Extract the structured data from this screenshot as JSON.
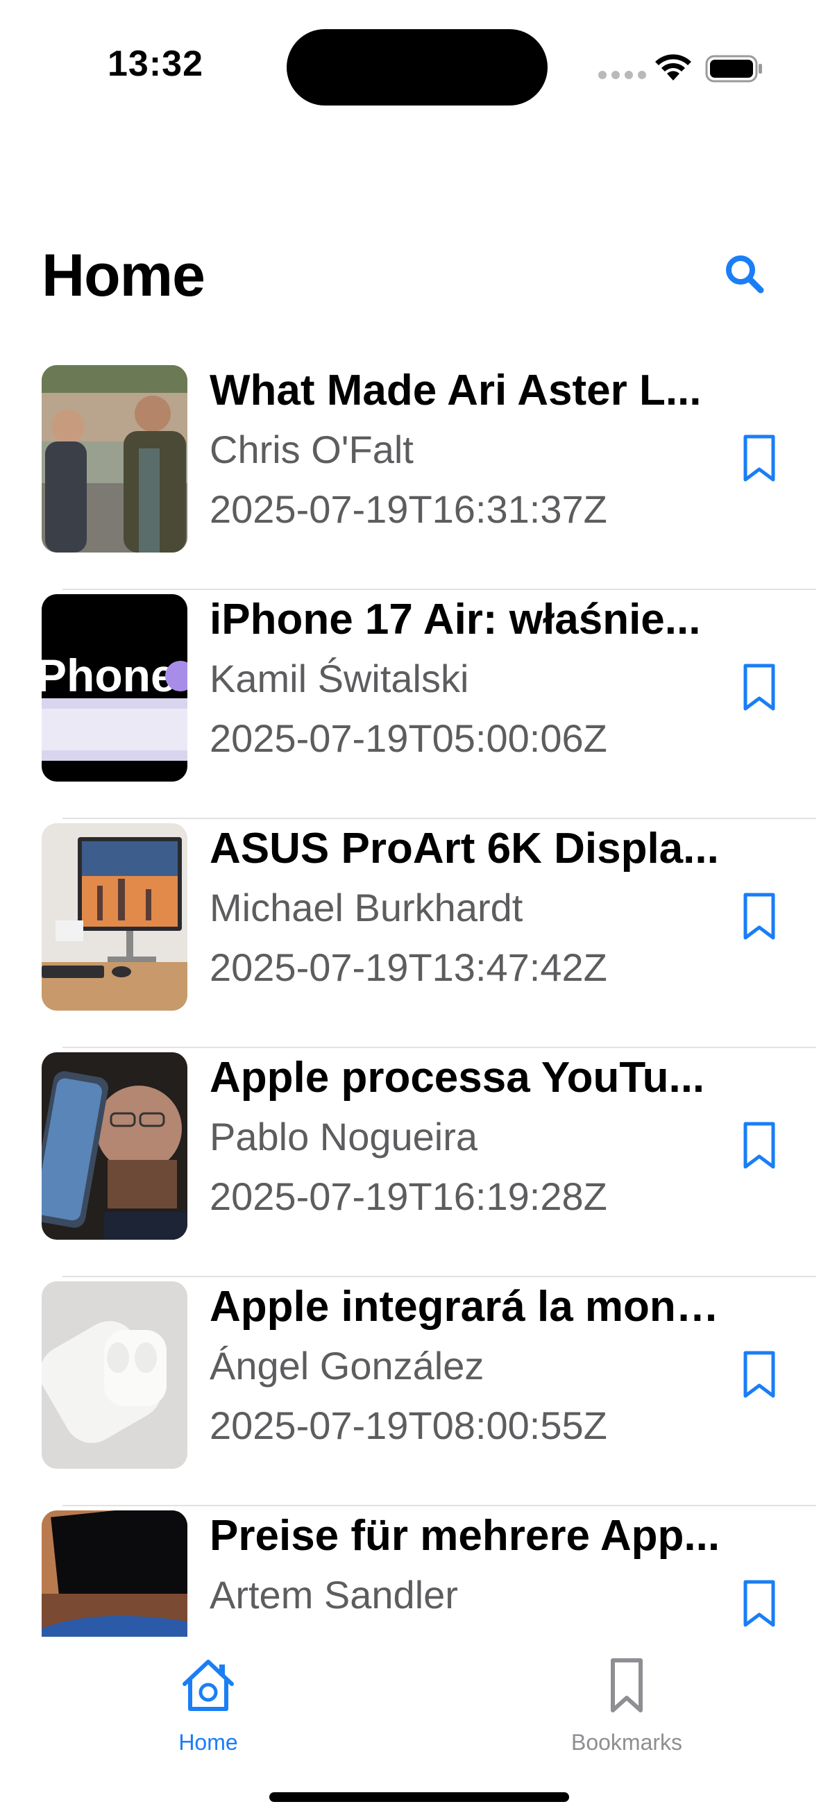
{
  "status_bar": {
    "time": "13:32"
  },
  "header": {
    "title": "Home",
    "search_icon": "magnifying-glass"
  },
  "colors": {
    "accent": "#1a7ef5",
    "secondary_text": "#5d5d60",
    "inactive_tab": "#8e8e93"
  },
  "articles": [
    {
      "title": "What Made Ari Aster L...",
      "author": "Chris O'Falt",
      "date": "2025-07-19T16:31:37Z"
    },
    {
      "title": "iPhone 17 Air: właśnie...",
      "author": "Kamil Świtalski",
      "date": "2025-07-19T05:00:06Z",
      "thumb_text": "Phone"
    },
    {
      "title": "ASUS ProArt 6K Displa...",
      "author": "Michael Burkhardt",
      "date": "2025-07-19T13:47:42Z"
    },
    {
      "title": "Apple processa YouTu...",
      "author": "Pablo Nogueira",
      "date": "2025-07-19T16:19:28Z"
    },
    {
      "title": "Apple integrará la moni...",
      "author": "Ángel González",
      "date": "2025-07-19T08:00:55Z"
    },
    {
      "title": "Preise für mehrere App...",
      "author": "Artem Sandler",
      "date": ""
    }
  ],
  "tabs": [
    {
      "label": "Home",
      "icon": "house-icon",
      "selected": true
    },
    {
      "label": "Bookmarks",
      "icon": "bookmark-icon",
      "selected": false
    }
  ]
}
